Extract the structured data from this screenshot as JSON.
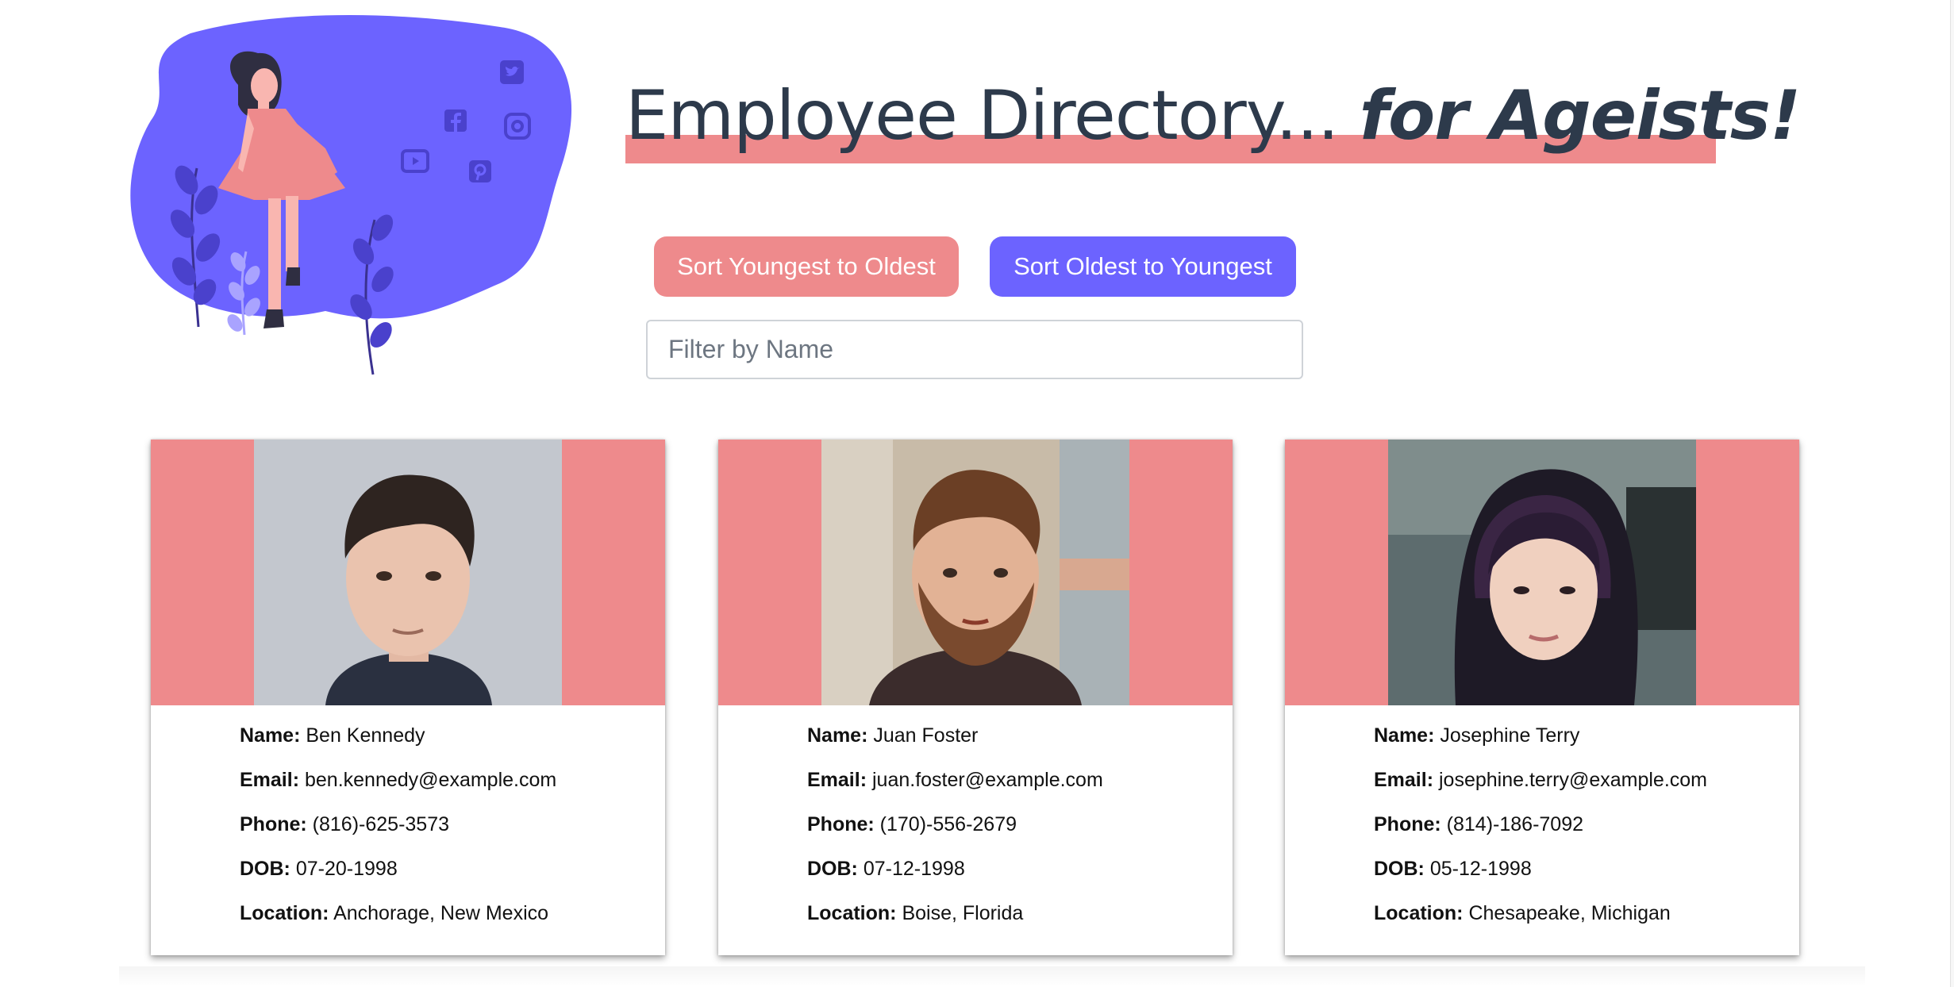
{
  "header": {
    "title_main": "Employee Directory...",
    "title_emphasis": "for Ageists!"
  },
  "controls": {
    "sort_young_label": "Sort Youngest to Oldest",
    "sort_old_label": "Sort Oldest to Youngest",
    "filter_placeholder": "Filter by Name",
    "filter_value": ""
  },
  "labels": {
    "name": "Name:",
    "email": "Email:",
    "phone": "Phone:",
    "dob": "DOB:",
    "location": "Location:"
  },
  "employees": [
    {
      "name": "Ben Kennedy",
      "email": "ben.kennedy@example.com",
      "phone": "(816)-625-3573",
      "dob": "07-20-1998",
      "location": "Anchorage, New Mexico"
    },
    {
      "name": "Juan Foster",
      "email": "juan.foster@example.com",
      "phone": "(170)-556-2679",
      "dob": "07-12-1998",
      "location": "Boise, Florida"
    },
    {
      "name": "Josephine Terry",
      "email": "josephine.terry@example.com",
      "phone": "(814)-186-7092",
      "dob": "05-12-1998",
      "location": "Chesapeake, Michigan"
    }
  ],
  "icons": [
    "twitter-icon",
    "facebook-icon",
    "instagram-icon",
    "youtube-icon",
    "pinterest-icon"
  ],
  "colors": {
    "accent_pink": "#ee8a8c",
    "accent_purple": "#6c63ff",
    "title_text": "#2d3a4b"
  }
}
